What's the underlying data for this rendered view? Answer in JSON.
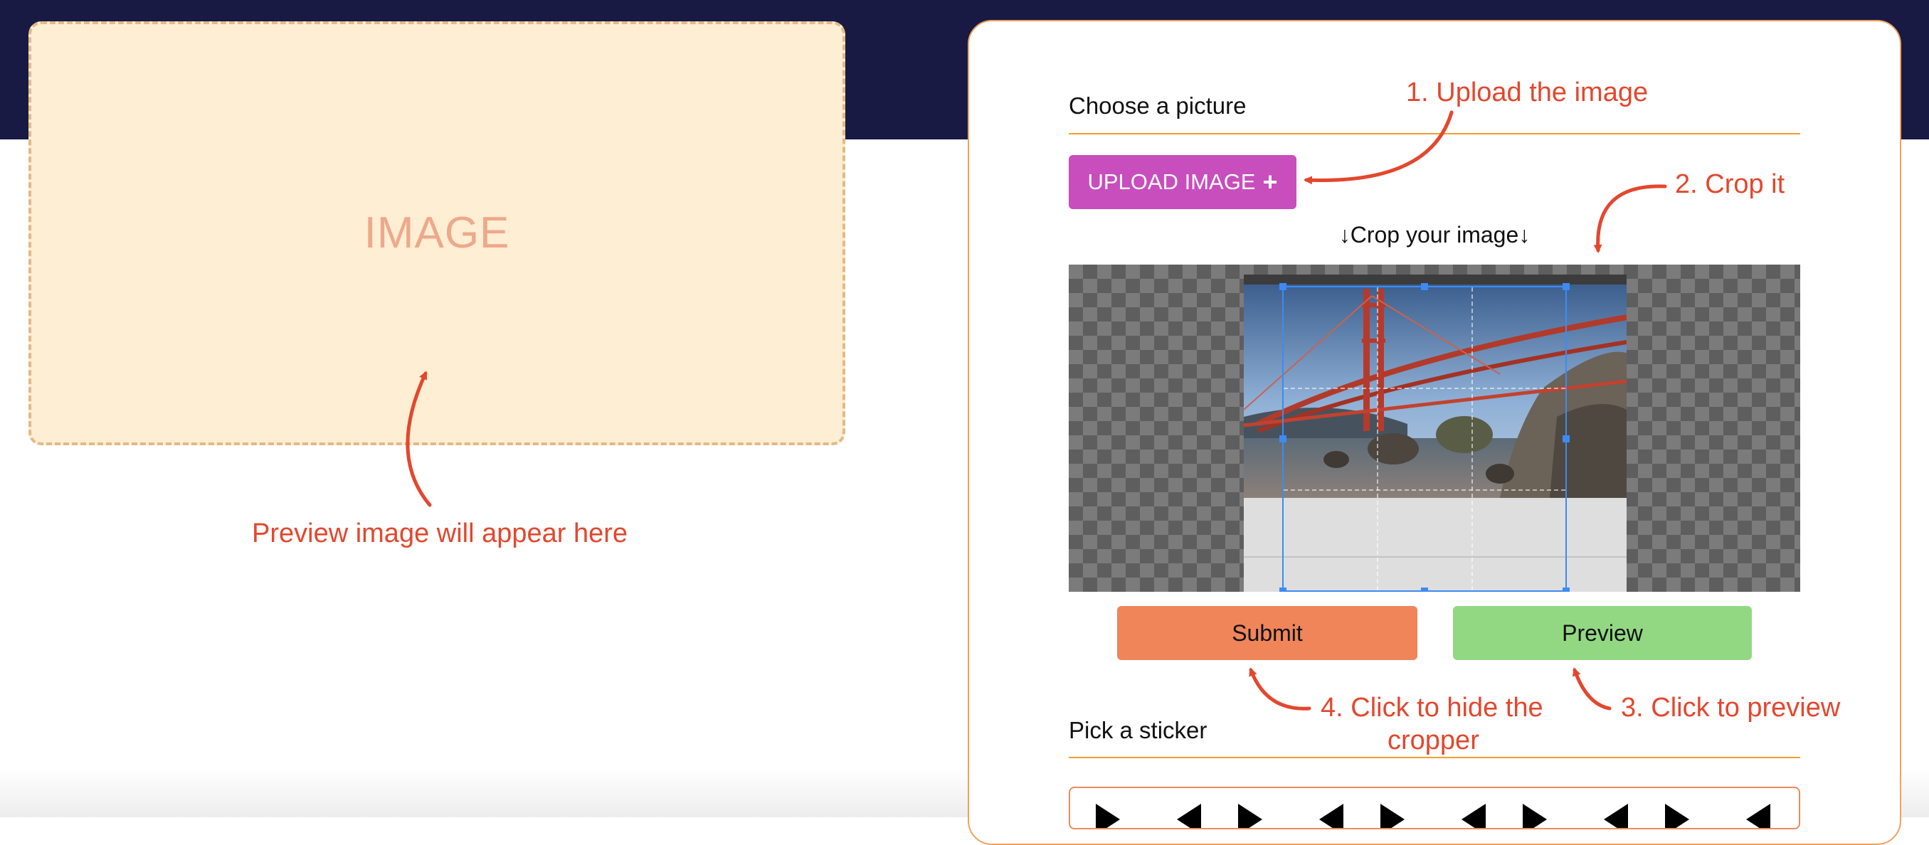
{
  "preview": {
    "placeholder": "IMAGE",
    "annotation": "Preview image will appear here"
  },
  "form": {
    "choose_title": "Choose a picture",
    "upload_label": "UPLOAD IMAGE",
    "upload_icon": "+",
    "crop_caption": "↓Crop your image↓",
    "submit_label": "Submit",
    "preview_label": "Preview",
    "sticker_title": "Pick a sticker"
  },
  "annotations": {
    "step1": "1. Upload the image",
    "step2": "2. Crop it",
    "step3": "3. Click to preview",
    "step4_line1": "4. Click to hide the",
    "step4_line2": "cropper"
  },
  "colors": {
    "header_band": "#181a44",
    "annotation": "#e3472e",
    "upload_button": "#c84dbd",
    "submit_button": "#f0855a",
    "preview_button": "#92d883",
    "crop_border": "#3d8bf2"
  }
}
